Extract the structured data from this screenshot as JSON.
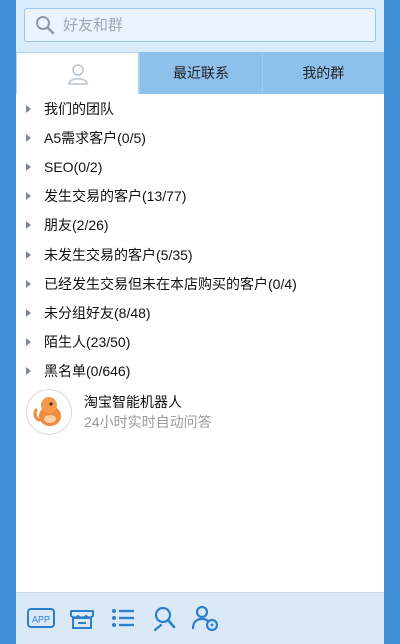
{
  "search": {
    "placeholder": "好友和群"
  },
  "tabs": [
    {
      "label": "",
      "icon": "person-icon",
      "active": true
    },
    {
      "label": "最近联系"
    },
    {
      "label": "我的群"
    }
  ],
  "groups": [
    {
      "label": "我们的团队"
    },
    {
      "label": "A5需求客户(0/5)"
    },
    {
      "label": "SEO(0/2)"
    },
    {
      "label": "发生交易的客户(13/77)"
    },
    {
      "label": "朋友(2/26)"
    },
    {
      "label": "未发生交易的客户(5/35)"
    },
    {
      "label": "已经发生交易但未在本店购买的客户(0/4)"
    },
    {
      "label": "未分组好友(8/48)"
    },
    {
      "label": "陌生人(23/50)"
    },
    {
      "label": "黑名单(0/646)"
    }
  ],
  "contact": {
    "name": "淘宝智能机器人",
    "desc": "24小时实时自动问答"
  },
  "toolbar": {
    "app_label": "APP",
    "icons": [
      "app-icon",
      "store-icon",
      "list-icon",
      "search-person-icon",
      "contact-settings-icon"
    ]
  },
  "colors": {
    "accent": "#3f8fd6",
    "tab_bar": "#8dc0ea",
    "icon_blue": "#2d7fd0"
  }
}
